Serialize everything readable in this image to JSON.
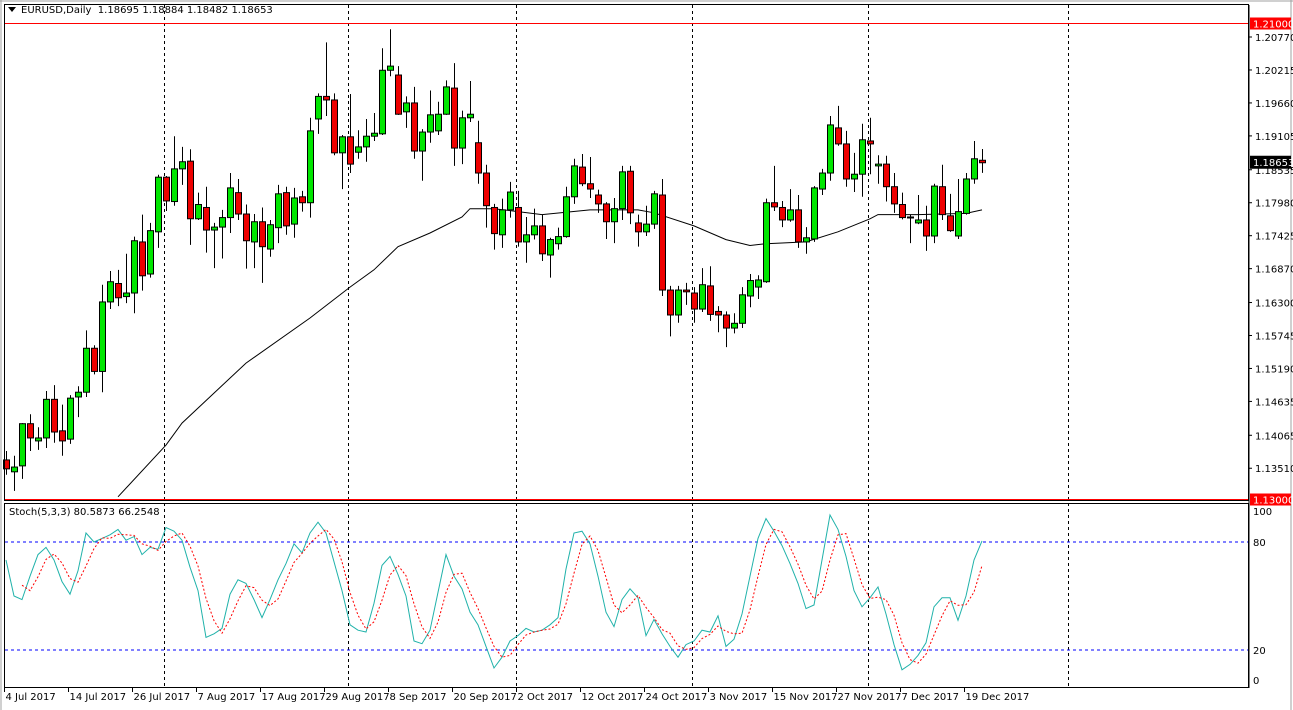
{
  "header": {
    "symbol": "EURUSD,Daily",
    "open": "1.18695",
    "high": "1.18884",
    "low": "1.18482",
    "close": "1.18653"
  },
  "stoch_header": {
    "label": "Stoch(5,3,3)",
    "main": "80.5873",
    "signal": "66.2548"
  },
  "colors": {
    "bull": "#00e600",
    "bear": "#ee0000",
    "outline": "#000000",
    "ma": "#000000",
    "stoch_main": "#20b2aa",
    "stoch_signal": "#ff0000",
    "levels": "#0000ff",
    "hline": "#ff0000"
  },
  "chart_data": [
    {
      "type": "candlestick",
      "title": "EURUSD,Daily",
      "ylim": [
        1.13,
        1.21
      ],
      "price_ticks": [
        "1.20770",
        "1.20215",
        "1.19660",
        "1.19105",
        "1.18535",
        "1.17980",
        "1.17425",
        "1.16870",
        "1.16300",
        "1.15745",
        "1.15190",
        "1.14635",
        "1.14065",
        "1.13510"
      ],
      "hlines": [
        {
          "price": 1.21,
          "label": "1.21000"
        },
        {
          "price": 1.13,
          "label": "1.13000"
        }
      ],
      "current_price": {
        "price": 1.18653,
        "label": "1.18653"
      },
      "period_separators_bar_index": [
        20,
        43,
        64,
        86,
        108,
        133
      ],
      "date_labels": [
        {
          "bar": 0,
          "text": "4 Jul 2017"
        },
        {
          "bar": 8,
          "text": "14 Jul 2017"
        },
        {
          "bar": 16,
          "text": "26 Jul 2017"
        },
        {
          "bar": 24,
          "text": "7 Aug 2017"
        },
        {
          "bar": 32,
          "text": "17 Aug 2017"
        },
        {
          "bar": 40,
          "text": "29 Aug 2017"
        },
        {
          "bar": 48,
          "text": "8 Sep 2017"
        },
        {
          "bar": 56,
          "text": "20 Sep 2017"
        },
        {
          "bar": 64,
          "text": "2 Oct 2017"
        },
        {
          "bar": 72,
          "text": "12 Oct 2017"
        },
        {
          "bar": 80,
          "text": "24 Oct 2017"
        },
        {
          "bar": 88,
          "text": "3 Nov 2017"
        },
        {
          "bar": 96,
          "text": "15 Nov 2017"
        },
        {
          "bar": 104,
          "text": "27 Nov 2017"
        },
        {
          "bar": 112,
          "text": "7 Dec 2017"
        },
        {
          "bar": 120,
          "text": "19 Dec 2017"
        }
      ],
      "ohlc": [
        [
          1.1365,
          1.138,
          1.134,
          1.135
        ],
        [
          1.1345,
          1.1372,
          1.1313,
          1.1353
        ],
        [
          1.1355,
          1.1427,
          1.1333,
          1.1426
        ],
        [
          1.1426,
          1.1442,
          1.138,
          1.1402
        ],
        [
          1.1397,
          1.142,
          1.1382,
          1.1402
        ],
        [
          1.1402,
          1.1481,
          1.1385,
          1.1467
        ],
        [
          1.1467,
          1.1491,
          1.1394,
          1.1412
        ],
        [
          1.1414,
          1.1458,
          1.1372,
          1.1397
        ],
        [
          1.14,
          1.1474,
          1.1392,
          1.1469
        ],
        [
          1.1471,
          1.1489,
          1.1437,
          1.1479
        ],
        [
          1.1479,
          1.1583,
          1.1471,
          1.1553
        ],
        [
          1.1553,
          1.1558,
          1.1509,
          1.1514
        ],
        [
          1.1514,
          1.166,
          1.1479,
          1.1631
        ],
        [
          1.1631,
          1.1683,
          1.1619,
          1.1665
        ],
        [
          1.1662,
          1.1685,
          1.1624,
          1.1638
        ],
        [
          1.164,
          1.1712,
          1.1629,
          1.1646
        ],
        [
          1.1646,
          1.1741,
          1.1612,
          1.1734
        ],
        [
          1.1732,
          1.1778,
          1.165,
          1.1675
        ],
        [
          1.1678,
          1.1764,
          1.1672,
          1.1751
        ],
        [
          1.1749,
          1.1845,
          1.1722,
          1.1841
        ],
        [
          1.1841,
          1.1843,
          1.1784,
          1.1801
        ],
        [
          1.18,
          1.191,
          1.1793,
          1.1855
        ],
        [
          1.1855,
          1.1892,
          1.1828,
          1.1867
        ],
        [
          1.1868,
          1.1888,
          1.1727,
          1.1771
        ],
        [
          1.1771,
          1.1815,
          1.1769,
          1.1795
        ],
        [
          1.179,
          1.1825,
          1.1714,
          1.1752
        ],
        [
          1.1752,
          1.1764,
          1.1688,
          1.1757
        ],
        [
          1.1757,
          1.1786,
          1.1704,
          1.1773
        ],
        [
          1.1773,
          1.1848,
          1.1747,
          1.1823
        ],
        [
          1.1815,
          1.1838,
          1.1769,
          1.1779
        ],
        [
          1.1779,
          1.1795,
          1.1687,
          1.1734
        ],
        [
          1.1732,
          1.1779,
          1.1688,
          1.1766
        ],
        [
          1.1766,
          1.179,
          1.1663,
          1.1724
        ],
        [
          1.172,
          1.1769,
          1.1707,
          1.1761
        ],
        [
          1.1756,
          1.1828,
          1.173,
          1.1813
        ],
        [
          1.1815,
          1.1825,
          1.1744,
          1.1759
        ],
        [
          1.1762,
          1.1823,
          1.1739,
          1.1806
        ],
        [
          1.1808,
          1.1818,
          1.1783,
          1.1798
        ],
        [
          1.1798,
          1.1941,
          1.1773,
          1.1919
        ],
        [
          1.1939,
          1.1982,
          1.1914,
          1.1977
        ],
        [
          1.1977,
          1.2068,
          1.1944,
          1.1971
        ],
        [
          1.1971,
          1.1982,
          1.1878,
          1.1882
        ],
        [
          1.1882,
          1.1912,
          1.1821,
          1.1909
        ],
        [
          1.1909,
          1.1981,
          1.1848,
          1.1863
        ],
        [
          1.1883,
          1.192,
          1.1872,
          1.1892
        ],
        [
          1.1892,
          1.1939,
          1.1867,
          1.191
        ],
        [
          1.191,
          1.1949,
          1.1902,
          1.1915
        ],
        [
          1.1914,
          1.2058,
          1.1912,
          1.2021
        ],
        [
          1.2021,
          1.209,
          1.2011,
          1.2028
        ],
        [
          1.2013,
          1.2028,
          1.1946,
          1.1947
        ],
        [
          1.1951,
          1.1977,
          1.1924,
          1.1966
        ],
        [
          1.1966,
          1.1993,
          1.1872,
          1.1885
        ],
        [
          1.1885,
          1.1922,
          1.1835,
          1.1917
        ],
        [
          1.1917,
          1.1987,
          1.1899,
          1.1946
        ],
        [
          1.1919,
          1.1968,
          1.1912,
          1.1947
        ],
        [
          1.1947,
          1.2004,
          1.1946,
          1.1993
        ],
        [
          1.1991,
          1.2033,
          1.186,
          1.189
        ],
        [
          1.189,
          1.1953,
          1.1863,
          1.1941
        ],
        [
          1.1941,
          1.2003,
          1.1934,
          1.1947
        ],
        [
          1.1899,
          1.1936,
          1.183,
          1.1848
        ],
        [
          1.1848,
          1.1862,
          1.1756,
          1.1793
        ],
        [
          1.179,
          1.1796,
          1.1719,
          1.1746
        ],
        [
          1.1744,
          1.1805,
          1.1722,
          1.1786
        ],
        [
          1.1786,
          1.1833,
          1.1773,
          1.1816
        ],
        [
          1.179,
          1.1818,
          1.1724,
          1.1732
        ],
        [
          1.1732,
          1.1774,
          1.1697,
          1.1744
        ],
        [
          1.1744,
          1.1788,
          1.1736,
          1.1759
        ],
        [
          1.1759,
          1.1778,
          1.17,
          1.1712
        ],
        [
          1.171,
          1.1739,
          1.1672,
          1.1736
        ],
        [
          1.1729,
          1.1756,
          1.1719,
          1.1741
        ],
        [
          1.1741,
          1.1825,
          1.1739,
          1.1808
        ],
        [
          1.1808,
          1.1872,
          1.1796,
          1.186
        ],
        [
          1.1858,
          1.188,
          1.1826,
          1.183
        ],
        [
          1.183,
          1.1875,
          1.1806,
          1.1821
        ],
        [
          1.1811,
          1.182,
          1.1781,
          1.1796
        ],
        [
          1.1796,
          1.1799,
          1.1737,
          1.1766
        ],
        [
          1.1766,
          1.1806,
          1.173,
          1.1788
        ],
        [
          1.1788,
          1.186,
          1.1769,
          1.185
        ],
        [
          1.1851,
          1.186,
          1.1762,
          1.1781
        ],
        [
          1.1764,
          1.1778,
          1.1724,
          1.1749
        ],
        [
          1.1749,
          1.1793,
          1.1742,
          1.1762
        ],
        [
          1.1762,
          1.1818,
          1.1754,
          1.1813
        ],
        [
          1.1811,
          1.1838,
          1.1641,
          1.1651
        ],
        [
          1.1651,
          1.1658,
          1.1573,
          1.1609
        ],
        [
          1.1609,
          1.1658,
          1.1596,
          1.1651
        ],
        [
          1.1651,
          1.1663,
          1.1626,
          1.1648
        ],
        [
          1.1646,
          1.1656,
          1.1596,
          1.1619
        ],
        [
          1.1619,
          1.1688,
          1.1614,
          1.166
        ],
        [
          1.1658,
          1.1691,
          1.1599,
          1.161
        ],
        [
          1.1615,
          1.1624,
          1.158,
          1.1609
        ],
        [
          1.1609,
          1.1615,
          1.1555,
          1.1587
        ],
        [
          1.1587,
          1.1612,
          1.1578,
          1.1595
        ],
        [
          1.1595,
          1.1656,
          1.1587,
          1.1643
        ],
        [
          1.1641,
          1.1678,
          1.1622,
          1.1667
        ],
        [
          1.1656,
          1.1676,
          1.1636,
          1.1668
        ],
        [
          1.1665,
          1.1805,
          1.1663,
          1.1798
        ],
        [
          1.1798,
          1.186,
          1.1784,
          1.1791
        ],
        [
          1.179,
          1.1801,
          1.1757,
          1.1769
        ],
        [
          1.1769,
          1.1821,
          1.1766,
          1.1786
        ],
        [
          1.1786,
          1.1811,
          1.1722,
          1.1732
        ],
        [
          1.1732,
          1.1757,
          1.1712,
          1.1739
        ],
        [
          1.1737,
          1.1826,
          1.1732,
          1.1823
        ],
        [
          1.1821,
          1.1855,
          1.1811,
          1.1848
        ],
        [
          1.1848,
          1.1944,
          1.1835,
          1.1929
        ],
        [
          1.1924,
          1.1961,
          1.1894,
          1.1897
        ],
        [
          1.1897,
          1.1919,
          1.1825,
          1.1838
        ],
        [
          1.1838,
          1.1882,
          1.1816,
          1.1846
        ],
        [
          1.1846,
          1.1931,
          1.1808,
          1.1904
        ],
        [
          1.1902,
          1.1941,
          1.1846,
          1.1897
        ],
        [
          1.186,
          1.1878,
          1.183,
          1.1863
        ],
        [
          1.1863,
          1.1877,
          1.18,
          1.1825
        ],
        [
          1.1825,
          1.1848,
          1.1781,
          1.1796
        ],
        [
          1.1795,
          1.1815,
          1.177,
          1.1773
        ],
        [
          1.1773,
          1.1778,
          1.173,
          1.1774
        ],
        [
          1.1764,
          1.1811,
          1.1762,
          1.1769
        ],
        [
          1.1769,
          1.1793,
          1.1717,
          1.1742
        ],
        [
          1.1742,
          1.183,
          1.173,
          1.1826
        ],
        [
          1.1825,
          1.1862,
          1.1769,
          1.1778
        ],
        [
          1.1776,
          1.1813,
          1.1749,
          1.1751
        ],
        [
          1.1742,
          1.1838,
          1.1737,
          1.1783
        ],
        [
          1.178,
          1.1848,
          1.1778,
          1.1838
        ],
        [
          1.1838,
          1.1902,
          1.183,
          1.1872
        ],
        [
          1.18695,
          1.18884,
          1.18482,
          1.18653
        ]
      ],
      "moving_average": [
        [
          14,
          1.1303
        ],
        [
          20,
          1.139
        ],
        [
          22,
          1.1427
        ],
        [
          30,
          1.1528
        ],
        [
          38,
          1.1604
        ],
        [
          43,
          1.1656
        ],
        [
          46,
          1.1685
        ],
        [
          49,
          1.1724
        ],
        [
          53,
          1.1747
        ],
        [
          57,
          1.1774
        ],
        [
          58,
          1.1788
        ],
        [
          61,
          1.1788
        ],
        [
          67,
          1.1778
        ],
        [
          73,
          1.1786
        ],
        [
          79,
          1.1786
        ],
        [
          81,
          1.1781
        ],
        [
          86,
          1.1759
        ],
        [
          90,
          1.1736
        ],
        [
          93,
          1.1726
        ],
        [
          95,
          1.1729
        ],
        [
          100,
          1.1732
        ],
        [
          104,
          1.1749
        ],
        [
          108,
          1.1771
        ],
        [
          109,
          1.1778
        ],
        [
          114,
          1.1778
        ],
        [
          120,
          1.178
        ],
        [
          122,
          1.1786
        ]
      ]
    },
    {
      "type": "line",
      "title": "Stoch(5,3,3)",
      "ylim": [
        0,
        100
      ],
      "levels": [
        80,
        20
      ],
      "y_ticks": [
        "100",
        "80",
        "20",
        "0"
      ],
      "signal_period": 3,
      "k_values": [
        70,
        50,
        48,
        61,
        73,
        77,
        70,
        58,
        51,
        64,
        85,
        80,
        82,
        84,
        87,
        81,
        83,
        73,
        77,
        76,
        88,
        86,
        81,
        66,
        53,
        27,
        29,
        32,
        51,
        59,
        57,
        48,
        38,
        48,
        59,
        68,
        79,
        74,
        85,
        91,
        85,
        69,
        53,
        34,
        31,
        30,
        46,
        67,
        72,
        62,
        50,
        25,
        23.5,
        31,
        52,
        73,
        61,
        54,
        41,
        34,
        22,
        10,
        16,
        25,
        28,
        32,
        30,
        31,
        34,
        38,
        65,
        85,
        86,
        79,
        61,
        41,
        33,
        48,
        54,
        49,
        28,
        37,
        29,
        22,
        16,
        23,
        25,
        31,
        30,
        39,
        22,
        26,
        40,
        61,
        82,
        93,
        86,
        78,
        68,
        57,
        43,
        45,
        70,
        95,
        87,
        72,
        53,
        44,
        49,
        55,
        40,
        23,
        9,
        12,
        17,
        24,
        44,
        49,
        49,
        36.5,
        50,
        70,
        80.6
      ]
    }
  ]
}
